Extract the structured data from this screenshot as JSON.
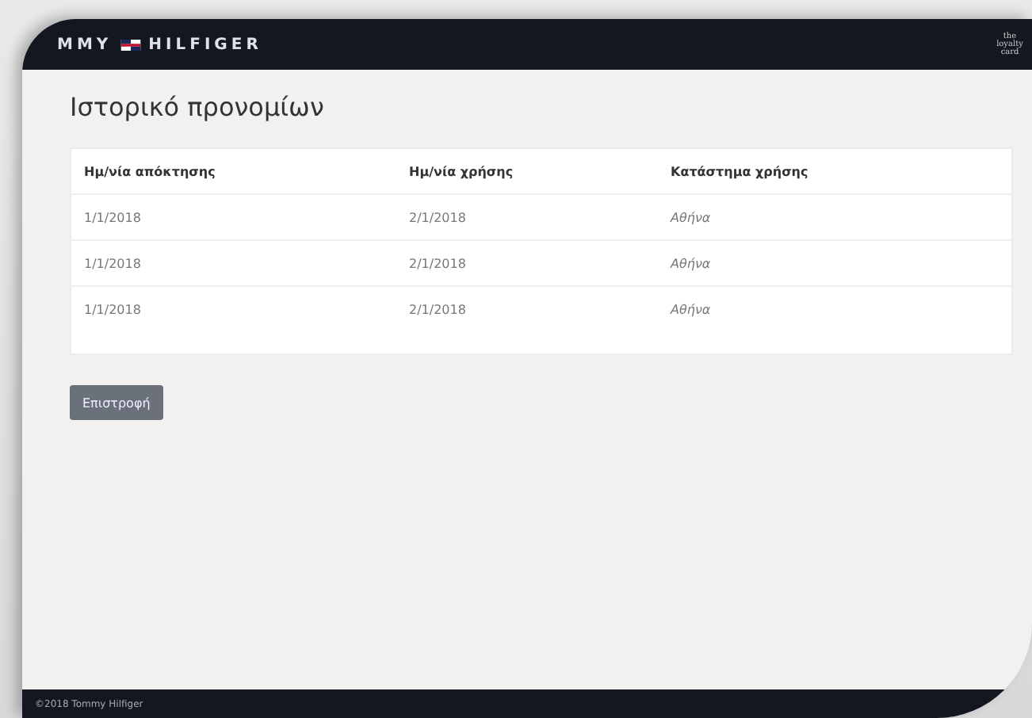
{
  "header": {
    "brand_left": "MMY",
    "brand_right": "HILFIGER",
    "side_logo": "the loyalty card"
  },
  "title": "Ιστορικό προνομίων",
  "table": {
    "columns": [
      "Ημ/νία απόκτησης",
      "Ημ/νία χρήσης",
      "Κατάστημα χρήσης"
    ],
    "rows": [
      [
        "1/1/2018",
        "2/1/2018",
        "Αθήνα"
      ],
      [
        "1/1/2018",
        "2/1/2018",
        "Αθήνα"
      ],
      [
        "1/1/2018",
        "2/1/2018",
        "Αθήνα"
      ]
    ]
  },
  "back_button": "Επιστροφή",
  "footer": "©2018 Tommy Hilfiger"
}
